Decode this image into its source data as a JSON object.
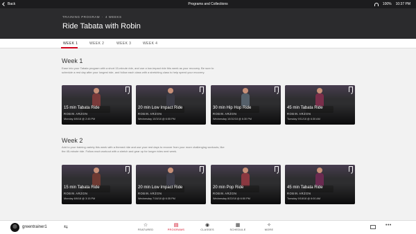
{
  "status_bar": {
    "back_label": "Back",
    "title": "Programs and Collections",
    "battery": "100%",
    "time": "10:37 PM"
  },
  "header": {
    "overline": "TRAINING PROGRAM",
    "weeks": "4 WEEKS",
    "title": "Ride Tabata with Robin"
  },
  "tabs": [
    {
      "label": "WEEK 1",
      "active": true
    },
    {
      "label": "WEEK 2",
      "active": false
    },
    {
      "label": "WEEK 3",
      "active": false
    },
    {
      "label": "WEEK 4",
      "active": false
    }
  ],
  "weeks": [
    {
      "title": "Week 1",
      "description": "Ease into your Tabata program with a short 15-minute ride, and use a low-impact ride this week as your recovery. Be sure to schedule a rest day after your longest ride, and follow each class with a stretching class to help speed your recovery.",
      "classes": [
        {
          "title": "15 min Tabata Ride",
          "instructor": "ROBIN ARZON",
          "date": "Monday 8/6/18 @ 2:45 PM",
          "accent": "#7a3a3a"
        },
        {
          "title": "20 min Low Impact Ride",
          "instructor": "ROBIN ARZON",
          "date": "Wednesday 10/3/18 @ 6:55 PM",
          "accent": "#3a3a44"
        },
        {
          "title": "30 min Hip Hop Ride",
          "instructor": "ROBIN ARZON",
          "date": "Wednesday 10/10/18 @ 6:30 PM",
          "accent": "#55606a"
        },
        {
          "title": "45 min Tabata Ride",
          "instructor": "ROBIN ARZON",
          "date": "Tuesday 9/11/18 @ 6:30 AM",
          "accent": "#7a2e4a"
        }
      ]
    },
    {
      "title": "Week 2",
      "description": "Add to your training variety this week with a themed ride and use your rest days to recover from your more challenging workouts, like the 45-minute ride. Follow each workout with a stretch and gear up for longer rides next week.",
      "classes": [
        {
          "title": "15 min Tabata Ride",
          "instructor": "ROBIN ARZON",
          "date": "Monday 8/6/18 @ 3:15 PM",
          "accent": "#6e3a32"
        },
        {
          "title": "20 min Low Impact Ride",
          "instructor": "ROBIN ARZON",
          "date": "Wednesday 7/16/18 @ 6:35 PM",
          "accent": "#3c3c48"
        },
        {
          "title": "20 min Pop Ride",
          "instructor": "ROBIN ARZON",
          "date": "Wednesday 8/22/18 @ 6:50 PM",
          "accent": "#8a3840"
        },
        {
          "title": "45 min Tabata Ride",
          "instructor": "ROBIN ARZON",
          "date": "Tuesday 9/18/18 @ 6:00 AM",
          "accent": "#6a2a50"
        }
      ]
    }
  ],
  "bottom_nav": {
    "username": "greentrainer1",
    "items": [
      {
        "label": "FEATURED",
        "icon": "star-icon",
        "glyph": "☆",
        "active": false
      },
      {
        "label": "PROGRAMS",
        "icon": "programs-icon",
        "glyph": "▤",
        "active": true
      },
      {
        "label": "CLASSES",
        "icon": "classes-icon",
        "glyph": "◉",
        "active": false
      },
      {
        "label": "SCHEDULE",
        "icon": "calendar-icon",
        "glyph": "▦",
        "active": false
      },
      {
        "label": "MORE",
        "icon": "more-icon",
        "glyph": "✧",
        "active": false
      }
    ]
  },
  "colors": {
    "accent": "#d0021b",
    "header_bg": "#2b2b2d",
    "status_bg": "#1c1c1e"
  }
}
